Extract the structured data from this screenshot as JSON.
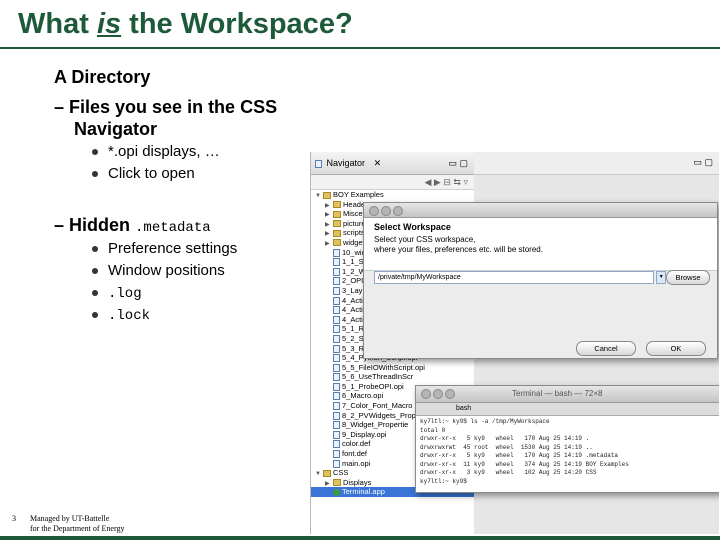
{
  "slide": {
    "title_part1": "What ",
    "title_em": "is",
    "title_part2": " the Workspace?",
    "heading": "A Directory",
    "dash1_line1": "– Files you see in the CSS",
    "dash1_line2": "Navigator",
    "bullets1": [
      "*.opi displays, …",
      "Click to open"
    ],
    "dash2_text": "– Hidden ",
    "dash2_code": ".metadata",
    "bullets2": [
      "Preference settings",
      "Window positions"
    ],
    "bullets2_code": [
      ".log",
      ".lock"
    ],
    "page_number": "3",
    "footer_line1": "Managed by UT-Battelle",
    "footer_line2": "for the Department of Energy"
  },
  "navigator": {
    "tab_label": "Navigator",
    "items": [
      {
        "label": "BOY Examples",
        "icon": "folder",
        "indent": 0
      },
      {
        "label": "Header",
        "icon": "folder",
        "indent": 1
      },
      {
        "label": "Miscell",
        "icon": "folder",
        "indent": 1
      },
      {
        "label": "pictures",
        "icon": "folder",
        "indent": 1
      },
      {
        "label": "scripts",
        "icon": "folder",
        "indent": 1
      },
      {
        "label": "widgets",
        "icon": "folder",
        "indent": 1
      },
      {
        "label": "10_wid",
        "icon": "file",
        "indent": 1
      },
      {
        "label": "1_1_Sh",
        "icon": "file",
        "indent": 1
      },
      {
        "label": "1_2_Wi",
        "icon": "file",
        "indent": 1
      },
      {
        "label": "2_OPI",
        "icon": "file",
        "indent": 1
      },
      {
        "label": "3_Lay",
        "icon": "file",
        "indent": 1
      },
      {
        "label": "4_Acti",
        "icon": "file",
        "indent": 1
      },
      {
        "label": "4_Acti",
        "icon": "file",
        "indent": 1
      },
      {
        "label": "4_Acti",
        "icon": "file",
        "indent": 1
      },
      {
        "label": "5_1_Ru",
        "icon": "file",
        "indent": 1
      },
      {
        "label": "5_2_Sp",
        "icon": "file",
        "indent": 1
      },
      {
        "label": "5_3_Ru",
        "icon": "file",
        "indent": 1
      },
      {
        "label": "5_4_Python_Script.opi",
        "icon": "file",
        "indent": 1
      },
      {
        "label": "5_5_FileIOWithScript.opi",
        "icon": "file",
        "indent": 1
      },
      {
        "label": "5_6_UseThreadInScr",
        "icon": "file",
        "indent": 1
      },
      {
        "label": "5_1_ProbeOPI.opi",
        "icon": "file",
        "indent": 1
      },
      {
        "label": "6_Macro.opi",
        "icon": "file",
        "indent": 1
      },
      {
        "label": "7_Color_Font_Macro",
        "icon": "file",
        "indent": 1
      },
      {
        "label": "8_2_PVWidgets_Prope",
        "icon": "file",
        "indent": 1
      },
      {
        "label": "8_Widget_Propertie",
        "icon": "file",
        "indent": 1
      },
      {
        "label": "9_Display.opi",
        "icon": "file",
        "indent": 1
      },
      {
        "label": "color.def",
        "icon": "file",
        "indent": 1
      },
      {
        "label": "font.def",
        "icon": "file",
        "indent": 1
      },
      {
        "label": "main.opi",
        "icon": "file",
        "indent": 1
      },
      {
        "label": "CSS",
        "icon": "folder",
        "indent": 0
      },
      {
        "label": "Displays",
        "icon": "folder",
        "indent": 1
      },
      {
        "label": "Terminal.app",
        "icon": "app",
        "indent": 1
      }
    ]
  },
  "dialog": {
    "header_title": "Select Workspace",
    "header_desc_line1": "Select your CSS workspace,",
    "header_desc_line2": "where your files, preferences etc. will be stored.",
    "field_label": "",
    "workspace_path": "/private/tmp/MyWorkspace",
    "browse_label": "Browse",
    "cancel_label": "Cancel",
    "ok_label": "OK"
  },
  "terminal": {
    "title": "Terminal — bash — 72×8",
    "tab_label": "bash",
    "lines": [
      "ky7ltl:~ ky9$ ls -a /tmp/MyWorkspace",
      "total 0",
      "drwxr-xr-x   5 ky9   wheel   170 Aug 25 14:19 .",
      "drwxrwxrwt  45 root  wheel  1530 Aug 25 14:19 ..",
      "drwxr-xr-x   5 ky9   wheel   170 Aug 25 14:19 .metadata",
      "drwxr-xr-x  11 ky9   wheel   374 Aug 25 14:19 BOY Examples",
      "drwxr-xr-x   3 ky9   wheel   102 Aug 25 14:20 CSS",
      "ky7ltl:~ ky9$"
    ]
  }
}
